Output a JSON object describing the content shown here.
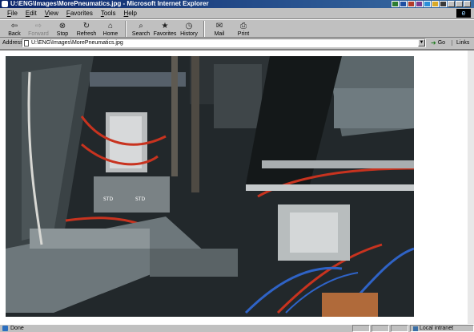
{
  "window": {
    "title": "U:\\ENG\\Images\\MorePneumatics.jpg - Microsoft Internet Explorer",
    "icon": "ie-page-icon"
  },
  "menu": [
    "File",
    "Edit",
    "View",
    "Favorites",
    "Tools",
    "Help"
  ],
  "toolbar": {
    "back": "Back",
    "forward": "Forward",
    "stop": "Stop",
    "refresh": "Refresh",
    "home": "Home",
    "search": "Search",
    "favorites": "Favorites",
    "history": "History",
    "mail": "Mail",
    "print": "Print"
  },
  "address": {
    "label": "Address",
    "value": "U:\\ENG\\Images\\MorePneumatics.jpg",
    "go": "Go",
    "links": "Links"
  },
  "content": {
    "image_subject": "pneumatic-machinery-photo",
    "photo_labels": [
      "STD",
      "STD"
    ]
  },
  "status": {
    "text": "Done",
    "zone": "Local intranet"
  },
  "colors": {
    "title_gradient_start": "#0a246a",
    "title_gradient_end": "#3a6ea5",
    "chrome": "#c0c0c0",
    "tubing_red": "#c8331f",
    "tubing_blue": "#2f63c6"
  }
}
